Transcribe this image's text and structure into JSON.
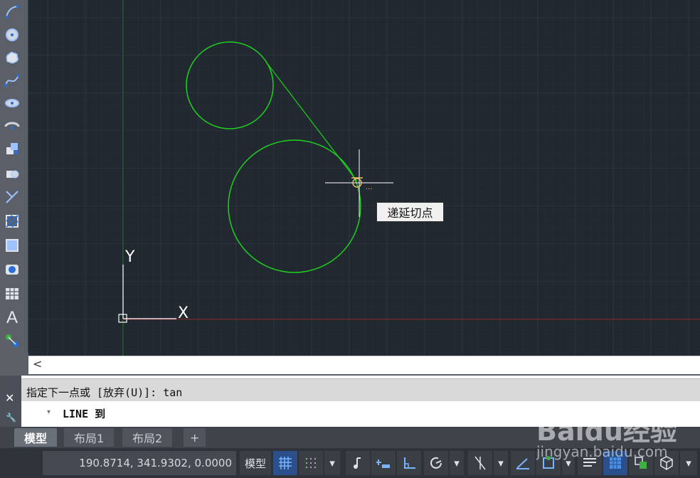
{
  "canvas": {
    "tooltip": "递延切点",
    "ucs_x_label": "X",
    "ucs_y_label": "Y",
    "colors": {
      "background": "#212830",
      "grid": "#2c3440",
      "circle": "#1fd11f",
      "crosshair": "#ffffff",
      "x_axis": "#8c2020",
      "y_axis": "#1a6e1a"
    }
  },
  "toolbar": {
    "tools": [
      "arc-icon",
      "circle-icon",
      "revision-cloud-icon",
      "spline-icon",
      "ellipse-icon",
      "ellipse-arc-icon",
      "insert-block-icon",
      "create-block-icon",
      "point-icon",
      "hatch-icon",
      "gradient-icon",
      "region-icon",
      "table-icon",
      "multiline-text-icon",
      "add-selected-icon"
    ],
    "text_tool_label": "A"
  },
  "scrollbar": {
    "left_arrow": "<"
  },
  "command": {
    "history": "指定下一点或 [放弃(U)]: tan",
    "prompt": "LINE 到",
    "close_symbol": "✕"
  },
  "tabs": [
    {
      "label": "模型",
      "active": true
    },
    {
      "label": "布局1",
      "active": false
    },
    {
      "label": "布局2",
      "active": false
    },
    {
      "label": "+",
      "active": false
    }
  ],
  "status": {
    "coordinates": "190.8714, 341.9302, 0.0000",
    "model_label": "模型"
  },
  "watermark": {
    "brand": "Baidu经验",
    "site": "jingyan.baidu.com"
  }
}
